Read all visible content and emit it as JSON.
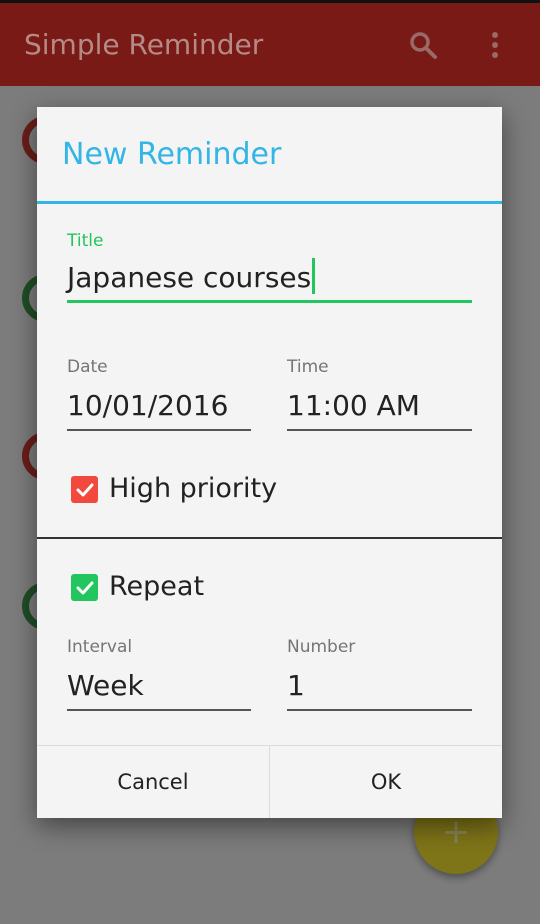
{
  "appbar": {
    "title": "Simple Reminder"
  },
  "dialog": {
    "title": "New Reminder",
    "title_field": {
      "label": "Title",
      "value": "Japanese courses"
    },
    "date_field": {
      "label": "Date",
      "value": "10/01/2016"
    },
    "time_field": {
      "label": "Time",
      "value": "11:00 AM"
    },
    "high_priority": {
      "label": "High priority",
      "checked": true
    },
    "repeat": {
      "label": "Repeat",
      "checked": true
    },
    "interval_field": {
      "label": "Interval",
      "value": "Week"
    },
    "number_field": {
      "label": "Number",
      "value": "1"
    },
    "cancel_label": "Cancel",
    "ok_label": "OK"
  },
  "colors": {
    "accent_blue": "#33b5e5",
    "accent_green": "#22c55e",
    "priority_red": "#f2483d",
    "appbar": "#7a1a16"
  },
  "icons": {
    "search": "search-icon",
    "overflow": "more-vert-icon",
    "fab": "plus-icon"
  }
}
